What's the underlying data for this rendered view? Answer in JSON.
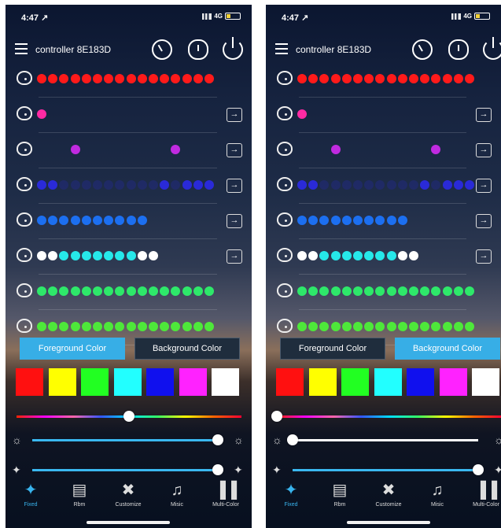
{
  "status": {
    "time": "4:47 ↗",
    "network": "4G"
  },
  "header": {
    "title": "controller 8E183D"
  },
  "mode_rows": [
    {
      "dots": [
        "#ff1a1a",
        "#ff1a1a",
        "#ff1a1a",
        "#ff1a1a",
        "#ff1a1a",
        "#ff1a1a",
        "#ff1a1a",
        "#ff1a1a",
        "#ff1a1a",
        "#ff1a1a",
        "#ff1a1a",
        "#ff1a1a",
        "#ff1a1a",
        "#ff1a1a",
        "#ff1a1a",
        "#ff1a1a"
      ],
      "arrow": false
    },
    {
      "dots": [
        "#ff2aa3"
      ],
      "arrow": true
    },
    {
      "dots": [
        null,
        null,
        null,
        "#c02ae0",
        null,
        null,
        null,
        null,
        null,
        null,
        null,
        null,
        "#c02ae0"
      ],
      "arrow": true
    },
    {
      "dots": [
        "#2a2ad8",
        "#2a2ad8",
        "f",
        "f",
        "f",
        "f",
        "f",
        "f",
        "f",
        "f",
        "f",
        "#2a2ad8",
        "f",
        "#2a2ad8",
        "#2a2ad8",
        "#2a2ad8"
      ],
      "arrow": true
    },
    {
      "dots": [
        "#1c6ff0",
        "#1c6ff0",
        "#1c6ff0",
        "#1c6ff0",
        "#1c6ff0",
        "#1c6ff0",
        "#1c6ff0",
        "#1c6ff0",
        "#1c6ff0",
        "#1c6ff0"
      ],
      "arrow": true
    },
    {
      "dots": [
        "#ffffff",
        "#ffffff",
        "#26e8ea",
        "#26e8ea",
        "#26e8ea",
        "#26e8ea",
        "#26e8ea",
        "#26e8ea",
        "#26e8ea",
        "#ffffff",
        "#ffffff"
      ],
      "arrow": true
    },
    {
      "dots": [
        "#2ee86a",
        "#2ee86a",
        "#2ee86a",
        "#2ee86a",
        "#2ee86a",
        "#2ee86a",
        "#2ee86a",
        "#2ee86a",
        "#2ee86a",
        "#2ee86a",
        "#2ee86a",
        "#2ee86a",
        "#2ee86a",
        "#2ee86a",
        "#2ee86a",
        "#2ee86a"
      ],
      "arrow": false
    },
    {
      "dots": [
        "#4ee83a",
        "#4ee83a",
        "#4ee83a",
        "#4ee83a",
        "#4ee83a",
        "#4ee83a",
        "#4ee83a",
        "#4ee83a",
        "#4ee83a",
        "#4ee83a",
        "#4ee83a",
        "#4ee83a",
        "#4ee83a",
        "#4ee83a",
        "#4ee83a",
        "#4ee83a"
      ],
      "arrow": false
    }
  ],
  "color_tabs": {
    "foreground": "Foreground Color",
    "background": "Background Color"
  },
  "swatches": [
    "#ff1010",
    "#ffff00",
    "#22ff22",
    "#22ffff",
    "#1010ee",
    "#ff22ff",
    "#ffffff"
  ],
  "screens": [
    {
      "active_tab": "foreground",
      "hue": 0.5,
      "brightness": 1.0,
      "speed": 1.0,
      "hue_as_white": false
    },
    {
      "active_tab": "background",
      "hue": 0.0,
      "brightness": 0.0,
      "speed": 1.0,
      "hue_as_white": true
    }
  ],
  "tabs": [
    {
      "label": "Fixed",
      "icon": "fixed-icon",
      "glyph": "✦"
    },
    {
      "label": "Rbm",
      "icon": "save-icon",
      "glyph": "▤"
    },
    {
      "label": "Customize",
      "icon": "tools-icon",
      "glyph": "✖"
    },
    {
      "label": "Misic",
      "icon": "music-icon",
      "glyph": "♫"
    },
    {
      "label": "Multi-Color",
      "icon": "bars-icon",
      "glyph": "▐▐"
    }
  ]
}
